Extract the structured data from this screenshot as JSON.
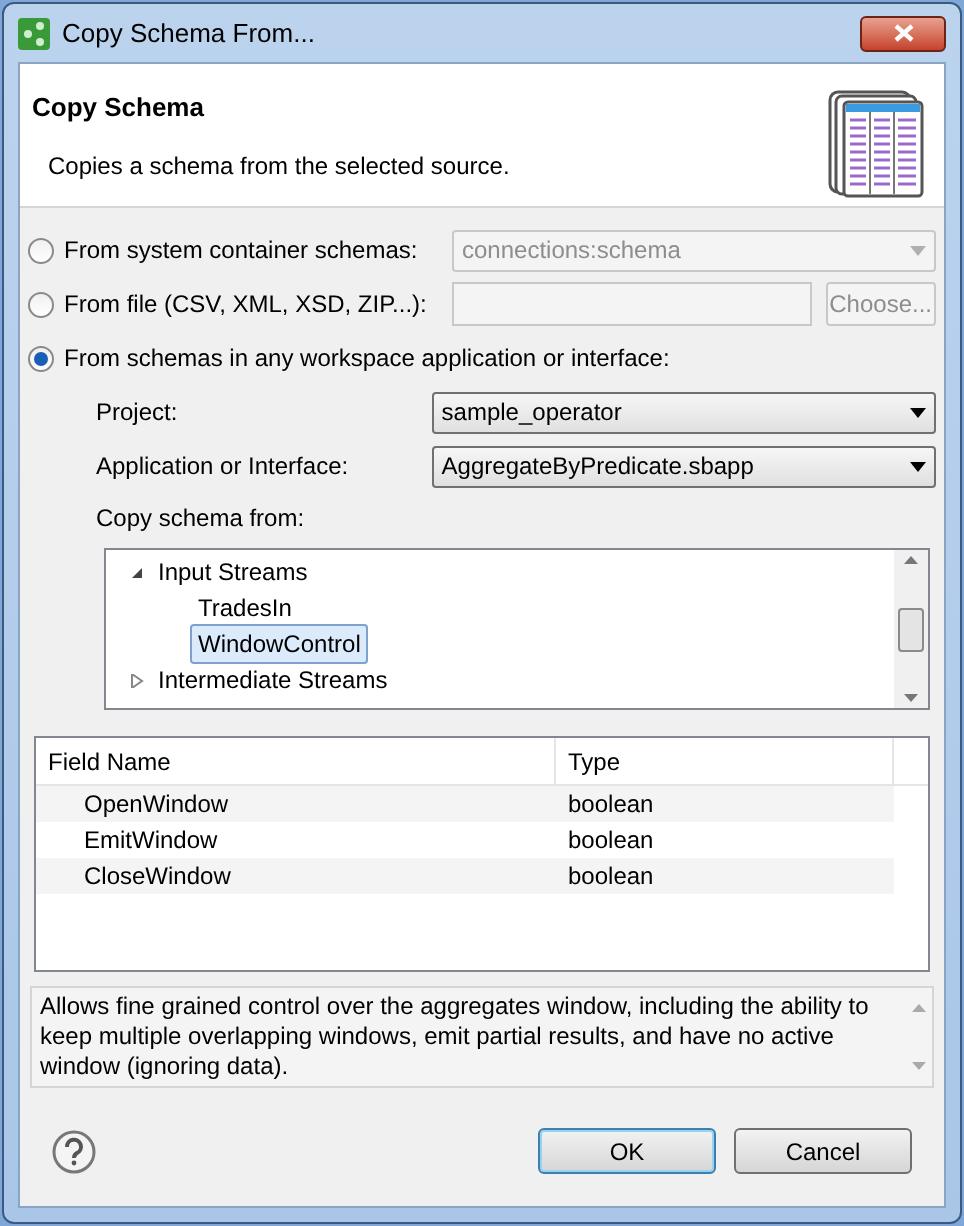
{
  "window": {
    "title": "Copy Schema From..."
  },
  "header": {
    "title": "Copy Schema",
    "description": "Copies a schema from the selected source."
  },
  "sources": [
    {
      "kind": "combo",
      "label": "From system container schemas:",
      "selected": false,
      "value": "connections:schema",
      "disabled": true
    },
    {
      "kind": "file",
      "label": "From file (CSV, XML, XSD, ZIP...):",
      "selected": false,
      "button": "Choose...",
      "disabled": true
    },
    {
      "kind": "workspace",
      "label": "From schemas in any workspace application or interface:",
      "selected": true
    }
  ],
  "project": {
    "label": "Project:",
    "value": "sample_operator"
  },
  "application": {
    "label": "Application or Interface:",
    "value": "AggregateByPredicate.sbapp"
  },
  "tree": {
    "label": "Copy schema from:",
    "items": [
      {
        "label": "Input Streams",
        "expanded": true,
        "selected": false,
        "children": [
          {
            "label": "TradesIn",
            "selected": false
          },
          {
            "label": "WindowControl",
            "selected": true
          }
        ]
      },
      {
        "label": "Intermediate Streams",
        "expanded": false,
        "selected": false
      }
    ]
  },
  "table": {
    "columns": [
      "Field Name",
      "Type"
    ],
    "rows": [
      {
        "name": "OpenWindow",
        "type": "boolean"
      },
      {
        "name": "EmitWindow",
        "type": "boolean"
      },
      {
        "name": "CloseWindow",
        "type": "boolean"
      }
    ]
  },
  "description": "Allows fine grained control over the aggregates window, including the ability to keep multiple overlapping windows, emit partial results, and have no active window (ignoring data).",
  "buttons": [
    {
      "label": "OK",
      "default": true
    },
    {
      "label": "Cancel",
      "default": false
    }
  ]
}
